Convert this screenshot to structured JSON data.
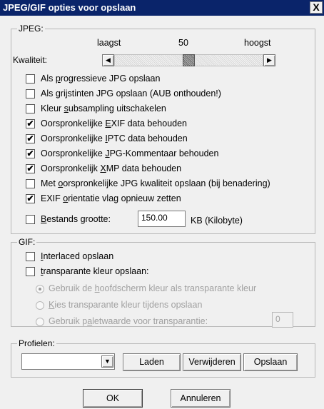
{
  "window": {
    "title": "JPEG/GIF opties voor opslaan",
    "close_label": "X"
  },
  "jpeg": {
    "legend": "JPEG:",
    "quality": {
      "low_label": "laagst",
      "value": "50",
      "high_label": "hoogst",
      "label": "Kwaliteit:",
      "level_percent": 50,
      "left_arrow": "◀",
      "right_arrow": "▶"
    },
    "options": [
      {
        "pre": "Als ",
        "acc": "p",
        "post": "rogressieve JPG opslaan",
        "checked": false
      },
      {
        "pre": "Als ",
        "acc": "g",
        "post": "rijstinten JPG opslaan (AUB onthouden!)",
        "checked": false
      },
      {
        "pre": "Kleur ",
        "acc": "s",
        "post": "ubsampling uitschakelen",
        "checked": false
      },
      {
        "pre": "Oorspronkelijke ",
        "acc": "E",
        "post": "XIF data behouden",
        "checked": true
      },
      {
        "pre": "Oorspronkelijke ",
        "acc": "I",
        "post": "PTC data behouden",
        "checked": true
      },
      {
        "pre": "Oorspronkelijke ",
        "acc": "J",
        "post": "PG-Kommentaar behouden",
        "checked": true
      },
      {
        "pre": "Oorspronkelijk ",
        "acc": "X",
        "post": "MP data behouden",
        "checked": true
      },
      {
        "pre": "Met ",
        "acc": "o",
        "post": "orspronkelijke JPG kwaliteit opslaan (bij benadering)",
        "checked": false
      },
      {
        "pre": "EXIF ",
        "acc": "o",
        "post": "rientatie vlag opnieuw zetten",
        "checked": true
      }
    ],
    "filesize": {
      "acc": "B",
      "post": "estands grootte:",
      "value": "150.00",
      "unit": "KB (Kilobyte)",
      "checked": false
    },
    "check_mark": "✔"
  },
  "gif": {
    "legend": "GIF:",
    "interlaced": {
      "acc": "I",
      "post": "nterlaced opslaan",
      "checked": false
    },
    "transparent": {
      "acc": "t",
      "post": "ransparante kleur opslaan:",
      "checked": false
    },
    "radios": [
      {
        "pre": "Gebruik de ",
        "acc": "h",
        "post": "oofdscherm kleur als transparante kleur",
        "selected": true
      },
      {
        "pre": "",
        "acc": "K",
        "post": "ies transparante kleur tijdens opslaan",
        "selected": false
      },
      {
        "pre": "Gebruik p",
        "acc": "a",
        "post": "letwaarde voor transparantie:",
        "selected": false
      }
    ],
    "palette_value": "0"
  },
  "profiles": {
    "legend": "Profielen:",
    "select_value": "",
    "dropdown_arrow": "▼",
    "load_label": "Laden",
    "delete_label": "Verwijderen",
    "save_label": "Opslaan"
  },
  "footer": {
    "ok_label": "OK",
    "cancel_label": "Annuleren"
  }
}
